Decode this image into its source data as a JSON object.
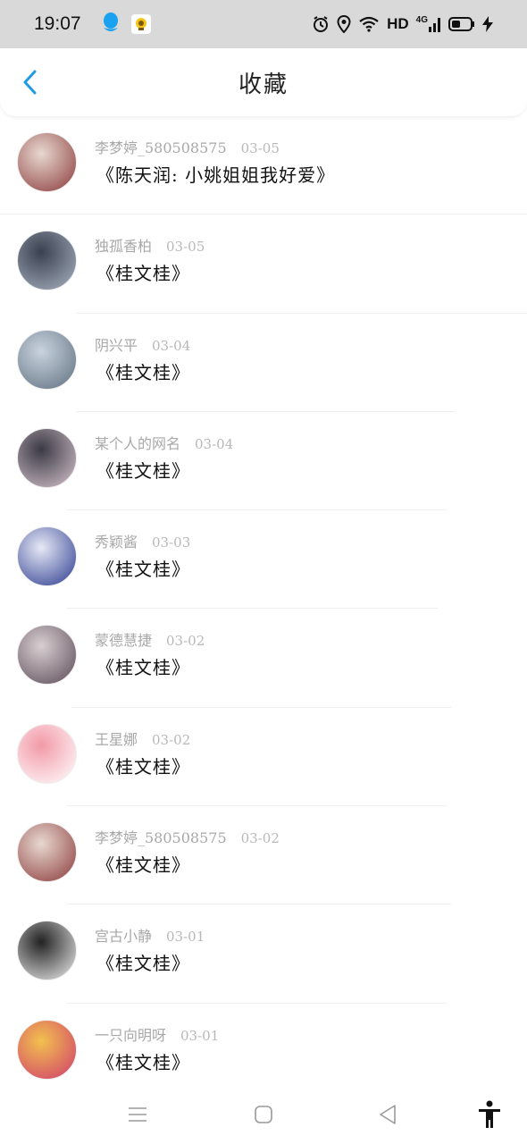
{
  "status_bar": {
    "time": "19:07",
    "hd": "HD",
    "network": "4G",
    "icons": [
      "qq-icon",
      "app-badge-icon",
      "alarm-icon",
      "location-icon",
      "wifi-icon",
      "signal-icon",
      "battery-icon",
      "charging-icon"
    ]
  },
  "header": {
    "title": "收藏",
    "back_icon": "chevron-left-icon",
    "accent": "#1e9be8"
  },
  "favorites": [
    {
      "author": "李梦婷_580508575",
      "date": "03-05",
      "title": "《陈天润: 小姚姐姐我好爱》",
      "avatar_colors": [
        "#8a3a3a",
        "#e8d8d0"
      ]
    },
    {
      "author": "独孤香柏",
      "date": "03-05",
      "title": "《桂文桂》",
      "avatar_colors": [
        "#a9b3c2",
        "#3a4150"
      ]
    },
    {
      "author": "阴兴平",
      "date": "03-04",
      "title": "《桂文桂》",
      "avatar_colors": [
        "#5f7080",
        "#c9d3de"
      ]
    },
    {
      "author": "某个人的网名",
      "date": "03-04",
      "title": "《桂文桂》",
      "avatar_colors": [
        "#d8c4cf",
        "#3a3a44"
      ]
    },
    {
      "author": "秀颖酱",
      "date": "03-03",
      "title": "《桂文桂》",
      "avatar_colors": [
        "#2b3a8f",
        "#e6e9f5"
      ]
    },
    {
      "author": "蒙德慧捷",
      "date": "03-02",
      "title": "《桂文桂》",
      "avatar_colors": [
        "#5a4a55",
        "#d9cfd2"
      ]
    },
    {
      "author": "王星娜",
      "date": "03-02",
      "title": "《桂文桂》",
      "avatar_colors": [
        "#ffffff",
        "#f29aa8"
      ]
    },
    {
      "author": "李梦婷_580508575",
      "date": "03-02",
      "title": "《桂文桂》",
      "avatar_colors": [
        "#8a3a3a",
        "#e8d8d0"
      ]
    },
    {
      "author": "宫古小静",
      "date": "03-01",
      "title": "《桂文桂》",
      "avatar_colors": [
        "#f0f0f0",
        "#222222"
      ]
    },
    {
      "author": "一只向明呀",
      "date": "03-01",
      "title": "《桂文桂》",
      "avatar_colors": [
        "#d03a6e",
        "#f2c14e"
      ]
    }
  ],
  "nav_bar": {
    "icons": [
      "menu-icon",
      "home-square-icon",
      "back-triangle-icon",
      "accessibility-icon"
    ]
  }
}
